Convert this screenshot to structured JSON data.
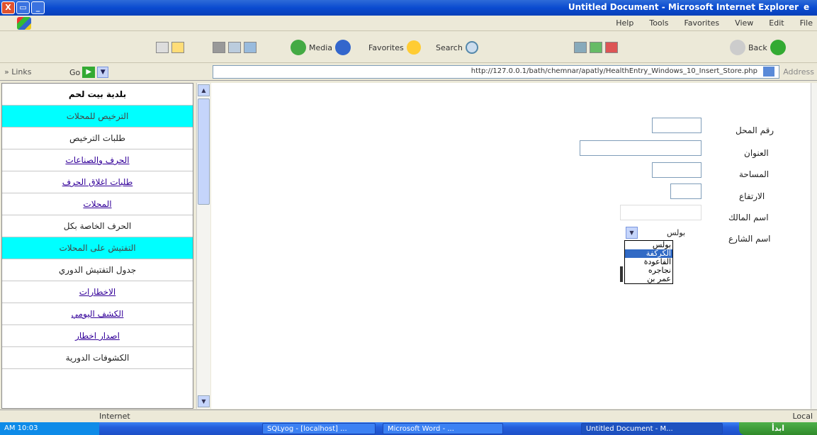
{
  "window": {
    "title": "Untitled Document - Microsoft Internet Explorer",
    "controls": [
      "X",
      "▭",
      "_"
    ]
  },
  "menu": [
    "Help",
    "Tools",
    "Favorites",
    "View",
    "Edit",
    "File"
  ],
  "toolbar": {
    "back": "Back",
    "search": "Search",
    "favorites": "Favorites",
    "media": "Media"
  },
  "address": {
    "links_label": "» Links",
    "go_label": "Go",
    "url": "http://127.0.0.1/bath/chemnar/apatly/HealthEntry_Windows_10_Insert_Store.php",
    "address_label": "Address"
  },
  "sidebar": {
    "items": [
      {
        "label": "بلدية بيت لحم",
        "style": "head"
      },
      {
        "label": "الترخيص للمحلات",
        "style": "hl"
      },
      {
        "label": "طلبات الترخيص",
        "style": "plain"
      },
      {
        "label": "الحرف والصناعات",
        "style": "link"
      },
      {
        "label": "طلبات اغلاق الحرف",
        "style": "link"
      },
      {
        "label": "المحلات",
        "style": "link"
      },
      {
        "label": "الحرف الخاصة بكل",
        "style": "plain"
      },
      {
        "label": "التفتيش على المحلات",
        "style": "hl"
      },
      {
        "label": "جدول التفتيش الدوري",
        "style": "plain"
      },
      {
        "label": "الاخطارات",
        "style": "link"
      },
      {
        "label": "الكشف اليومي",
        "style": "link"
      },
      {
        "label": "اصدار اخطار",
        "style": "link"
      },
      {
        "label": "الكشوفات الدورية",
        "style": "plain"
      }
    ]
  },
  "form": {
    "fields": [
      {
        "label": "رقم المحل"
      },
      {
        "label": "العنوان"
      },
      {
        "label": "المساحة"
      },
      {
        "label": "الارتفاع"
      },
      {
        "label": "اسم المالك"
      },
      {
        "label": "اسم الشارع"
      }
    ],
    "street_select_value": "بولس",
    "street_options": [
      "بولس",
      "الكركفة",
      "القاعودة",
      "نجاجره",
      "عمر بن"
    ],
    "selected_option_index": 1
  },
  "status": {
    "zone": "Internet",
    "right": "Local"
  },
  "taskbar": {
    "tray_time": "AM 10:03",
    "tasks": [
      "SQLyog - [localhost] ...",
      "Microsoft Word - ...",
      "Untitled Document - M..."
    ],
    "start": "ابدأ"
  },
  "colors": {
    "title_blue": "#0a4bd0",
    "highlight_cyan": "#00ffff",
    "link_purple": "#330099",
    "selected_option": "#316ac5"
  }
}
